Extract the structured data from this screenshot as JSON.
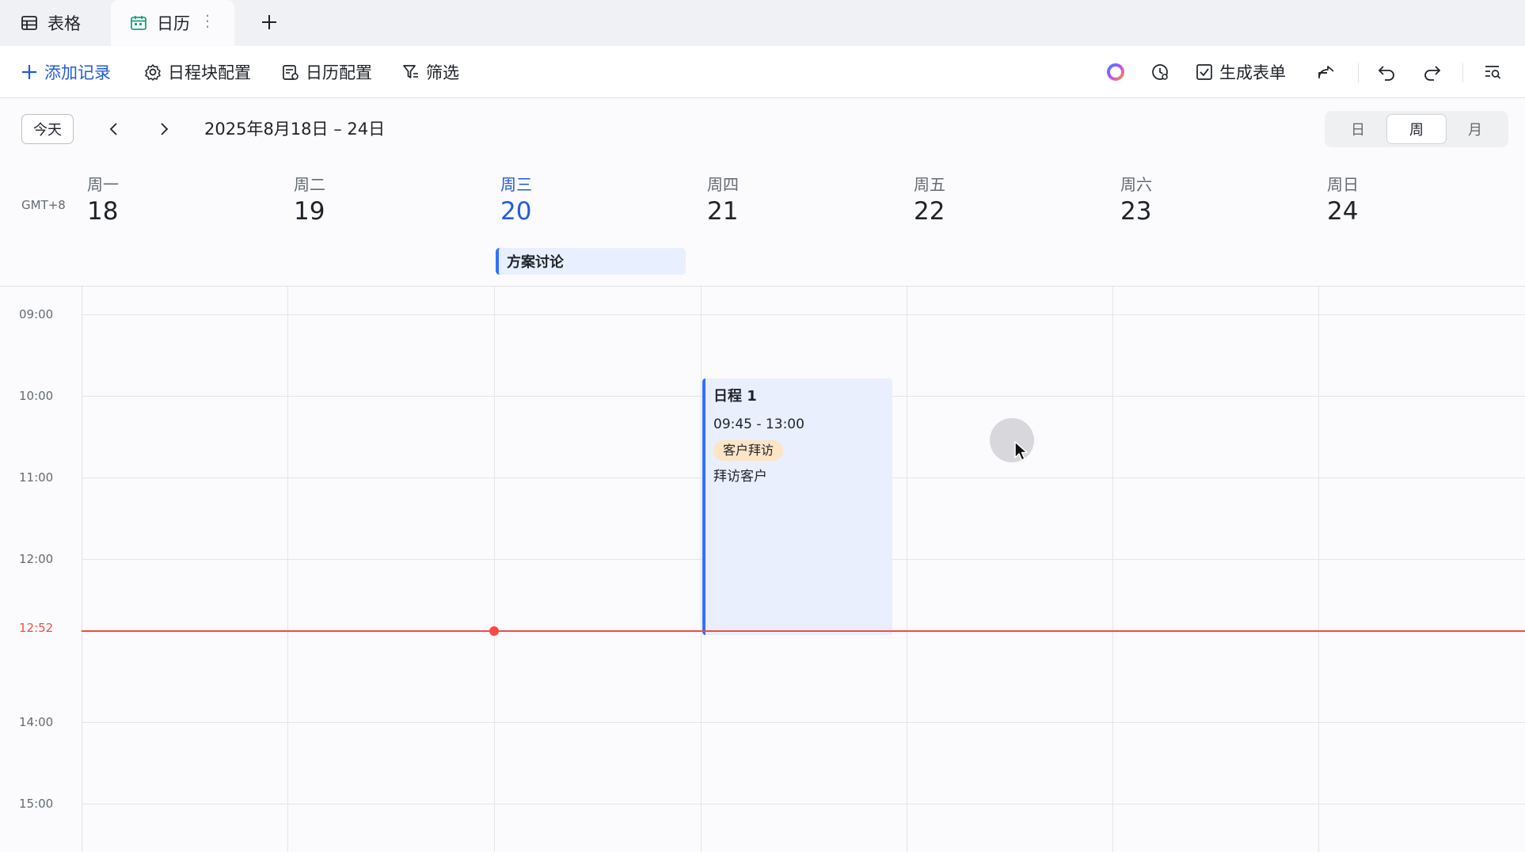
{
  "tabs": [
    {
      "label": "表格",
      "icon": "table-icon"
    },
    {
      "label": "日历",
      "icon": "calendar-icon",
      "active": true
    }
  ],
  "toolbar": {
    "add_record": "添加记录",
    "block_config": "日程块配置",
    "calendar_config": "日历配置",
    "filter": "筛选",
    "generate_form": "生成表单"
  },
  "nav": {
    "today": "今天",
    "range": "2025年8月18日 – 24日"
  },
  "views": {
    "day": "日",
    "week": "周",
    "month": "月",
    "selected": "周"
  },
  "timezone": "GMT+8",
  "days": [
    {
      "name": "周一",
      "num": "18"
    },
    {
      "name": "周二",
      "num": "19"
    },
    {
      "name": "周三",
      "num": "20",
      "today": true
    },
    {
      "name": "周四",
      "num": "21"
    },
    {
      "name": "周五",
      "num": "22"
    },
    {
      "name": "周六",
      "num": "23"
    },
    {
      "name": "周日",
      "num": "24"
    }
  ],
  "allday_events": [
    {
      "title": "方案讨论",
      "day": "周三"
    }
  ],
  "hours": [
    "09:00",
    "10:00",
    "11:00",
    "12:00",
    "14:00",
    "15:00"
  ],
  "now": "12:52",
  "event": {
    "title": "日程 1",
    "time": "09:45 - 13:00",
    "tag": "客户拜访",
    "desc": "拜访客户",
    "day": "周四"
  },
  "colors": {
    "accent": "#245bdb",
    "event_border": "#3370ff",
    "event_bg": "#e9effd",
    "now": "#f54a45",
    "tag_bg": "#fbe5c5"
  }
}
